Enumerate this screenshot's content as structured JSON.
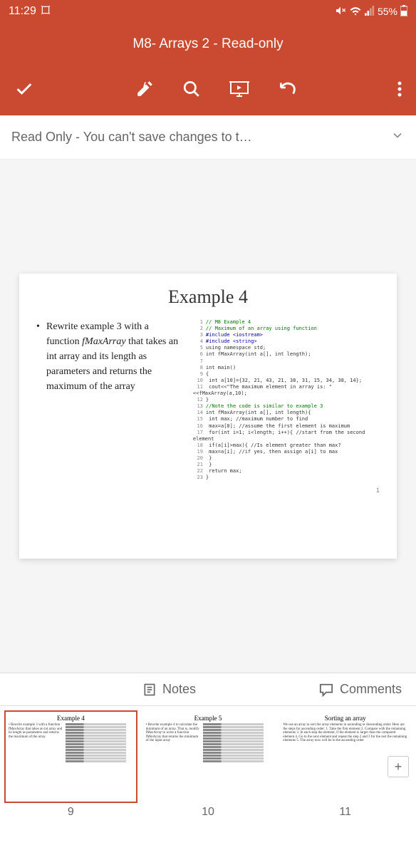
{
  "status": {
    "time": "11:29",
    "battery": "55%"
  },
  "header": {
    "title": "M8- Arrays 2 - Read-only"
  },
  "banner": {
    "text": "Read Only - You can't save changes to t…"
  },
  "slide": {
    "title": "Example 4",
    "bullets": [
      "Rewrite example 3 with a function fMaxArray that takes an int array and its length as parameters and returns the maximum of the array"
    ],
    "code": {
      "lines": [
        {
          "n": "1",
          "t": "// M8  Example 4",
          "c": "cm"
        },
        {
          "n": "2",
          "t": "// Maximum of an array using function",
          "c": "cm"
        },
        {
          "n": "3",
          "t": "#include <iostream>",
          "c": "kw"
        },
        {
          "n": "4",
          "t": "#include <string>",
          "c": "kw"
        },
        {
          "n": "5",
          "t": "using namespace std;",
          "c": ""
        },
        {
          "n": "6",
          "t": "int fMaxArray(int a[], int length);",
          "c": ""
        },
        {
          "n": "7",
          "t": "",
          "c": ""
        },
        {
          "n": "8",
          "t": "int main()",
          "c": ""
        },
        {
          "n": "9",
          "t": "{",
          "c": ""
        },
        {
          "n": "10",
          "t": "  int a[10]={32, 21, 43, 21, 38, 31, 15, 34, 38, 14};",
          "c": ""
        },
        {
          "n": "11",
          "t": "  cout<<\"The maximum element in array is: \"<<fMaxArray(a,10);",
          "c": ""
        },
        {
          "n": "12",
          "t": "}",
          "c": ""
        },
        {
          "n": "13",
          "t": "//Note the code is similar to example 3",
          "c": "cm"
        },
        {
          "n": "14",
          "t": "int fMaxArray(int a[], int length){",
          "c": ""
        },
        {
          "n": "15",
          "t": "  int max;  //maximum number to find",
          "c": ""
        },
        {
          "n": "16",
          "t": "  max=a[0];  //assume the first element is maximum",
          "c": ""
        },
        {
          "n": "17",
          "t": "  for(int i=1; i<length; i++){ //start from the second element",
          "c": ""
        },
        {
          "n": "18",
          "t": "    if(a[i]>max){      //Is element greater than max?",
          "c": ""
        },
        {
          "n": "19",
          "t": "      max=a[i];      //if yes, then assign a[i] to max",
          "c": ""
        },
        {
          "n": "20",
          "t": "    }",
          "c": ""
        },
        {
          "n": "21",
          "t": "  }",
          "c": ""
        },
        {
          "n": "22",
          "t": "  return max;",
          "c": ""
        },
        {
          "n": "23",
          "t": "}",
          "c": ""
        }
      ]
    },
    "page_num": "1"
  },
  "bottom": {
    "notes": "Notes",
    "comments": "Comments"
  },
  "thumbs": [
    {
      "title": "Example 4",
      "left": "• Rewrite example 3 with a function fMaxArray that takes an int array and its length as parameters and returns the maximum of the array",
      "num": "9",
      "active": true
    },
    {
      "title": "Example 5",
      "left": "• Rewrite example 4 to calculate the minimum of an array. That is, modify fMaxArray to write a function fMinArray that returns the minimum of the input array",
      "num": "10",
      "active": false
    },
    {
      "title": "Sorting an array",
      "left": "We use an array to sort the array elements in ascending or descending order. Here are the steps for ascending order:\n1. Take the first element\n2. Compare with the remaining elements\n3. In each step the element, if the element is larger than the compared element\n4. Go to the next element and repeat the step 2 and 3 for the rest the remaining elements\n5. The array now will be in the ascending order",
      "num": "11",
      "active": false
    }
  ]
}
